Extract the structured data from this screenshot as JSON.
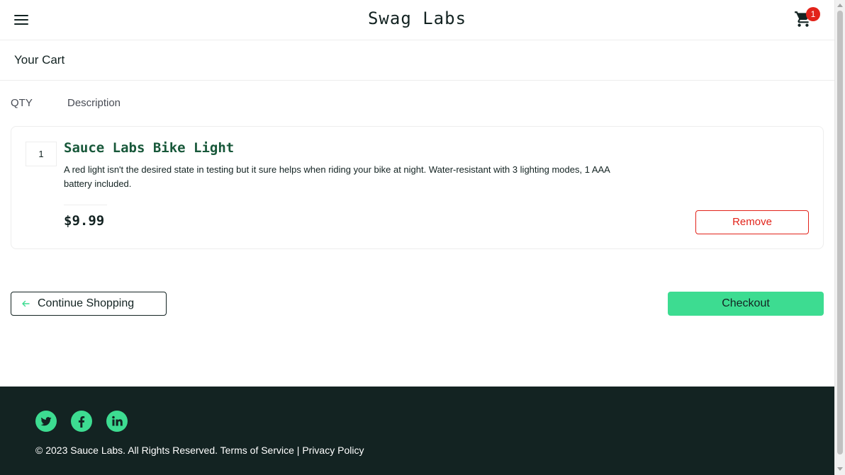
{
  "header": {
    "app_logo": "Swag Labs",
    "cart_badge_count": "1"
  },
  "secondary_header": {
    "title": "Your Cart"
  },
  "cart_list": {
    "qty_label": "QTY",
    "description_label": "Description",
    "items": [
      {
        "quantity": "1",
        "name": "Sauce Labs Bike Light",
        "description": "A red light isn't the desired state in testing but it sure helps when riding your bike at night. Water-resistant with 3 lighting modes, 1 AAA battery included.",
        "price": "$9.99",
        "remove_label": "Remove"
      }
    ]
  },
  "actions": {
    "continue_shopping_label": "Continue Shopping",
    "checkout_label": "Checkout"
  },
  "footer": {
    "social_icons": [
      "twitter-icon",
      "facebook-icon",
      "linkedin-icon"
    ],
    "copyright": "© 2023 Sauce Labs. All Rights Reserved. Terms of Service | Privacy Policy"
  },
  "colors": {
    "accent_green": "#3ddc91",
    "dark": "#132322",
    "remove_red": "#e2231a",
    "item_name_green": "#18583a"
  }
}
